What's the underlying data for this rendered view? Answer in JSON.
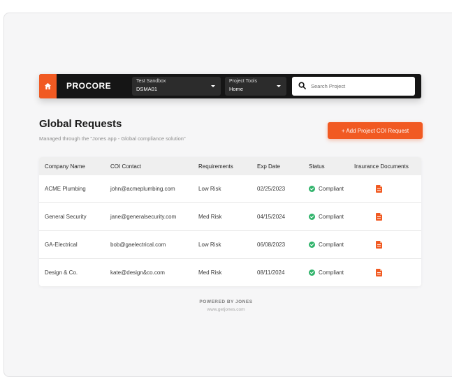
{
  "navbar": {
    "logo": "PROCORE",
    "company_select": {
      "label": "Test Sandbox",
      "value": "DSMA01"
    },
    "tools_select": {
      "label": "Project Tools",
      "value": "Home"
    },
    "search": {
      "placeholder": "Search Project"
    }
  },
  "header": {
    "title": "Global Requests",
    "subtitle": "Managed through the \"Jones app - Global compliance solution\"",
    "add_button": "+ Add Project COI Request"
  },
  "table": {
    "columns": [
      "Company Name",
      "COI Contact",
      "Requirements",
      "Exp Date",
      "Status",
      "Insurance Documents"
    ],
    "rows": [
      {
        "company": "ACME Plumbing",
        "contact": "john@acmeplumbing.com",
        "requirements": "Low Risk",
        "exp": "02/25/2023",
        "status": "Compliant"
      },
      {
        "company": "General Security",
        "contact": "jane@generalsecurity.com",
        "requirements": "Med Risk",
        "exp": "04/15/2024",
        "status": "Compliant"
      },
      {
        "company": "GA-Electrical",
        "contact": "bob@gaelectrical.com",
        "requirements": "Low Risk",
        "exp": "06/08/2023",
        "status": "Compliant"
      },
      {
        "company": "Design & Co.",
        "contact": "kate@design&co.com",
        "requirements": "Med Risk",
        "exp": "08/11/2024",
        "status": "Compliant"
      }
    ]
  },
  "footer": {
    "brand": "POWERED BY JONES",
    "url": "www.getjones.com"
  },
  "colors": {
    "accent": "#f15a22",
    "nav_bg": "#151515",
    "compliant": "#2fb36a"
  },
  "icons": [
    "home-icon",
    "caret-down-icon",
    "search-icon",
    "check-circle-icon",
    "document-icon"
  ]
}
